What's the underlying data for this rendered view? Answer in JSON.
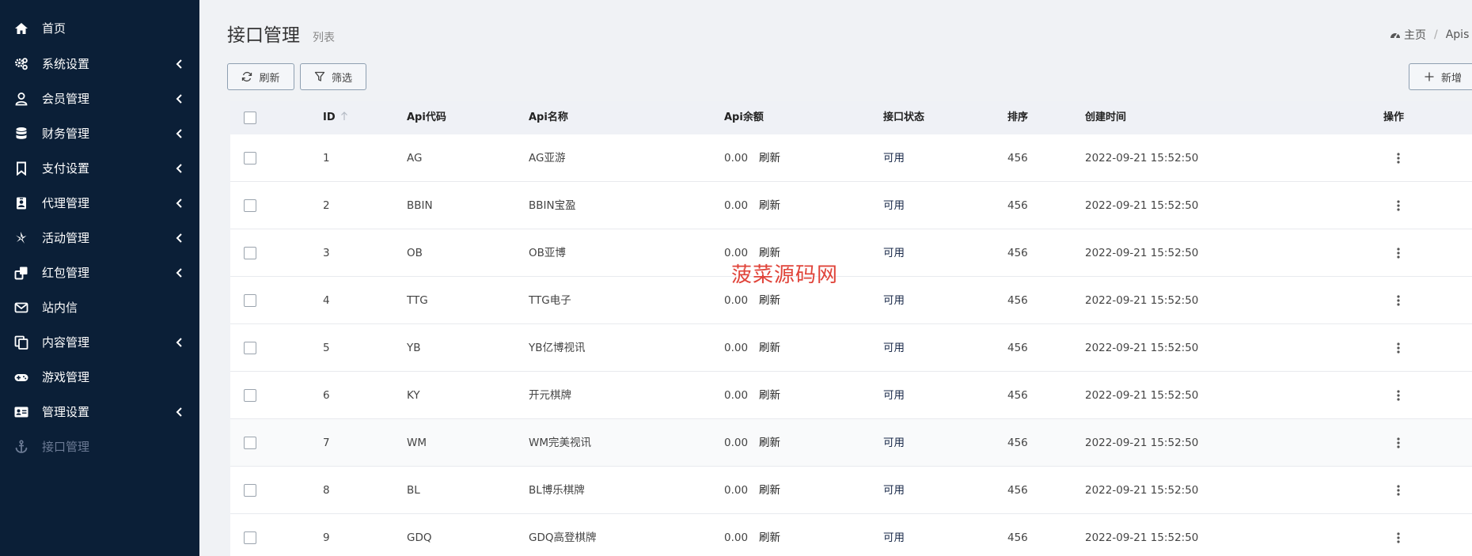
{
  "sidebar": {
    "items": [
      {
        "label": "首页",
        "icon": "home-icon",
        "has_chevron": false
      },
      {
        "label": "系统设置",
        "icon": "cogs-icon",
        "has_chevron": true
      },
      {
        "label": "会员管理",
        "icon": "user-icon",
        "has_chevron": true
      },
      {
        "label": "财务管理",
        "icon": "database-icon",
        "has_chevron": true
      },
      {
        "label": "支付设置",
        "icon": "bookmark-icon",
        "has_chevron": true
      },
      {
        "label": "代理管理",
        "icon": "id-badge-icon",
        "has_chevron": true
      },
      {
        "label": "活动管理",
        "icon": "pinwheel-icon",
        "has_chevron": true
      },
      {
        "label": "红包管理",
        "icon": "clone-icon",
        "has_chevron": true
      },
      {
        "label": "站内信",
        "icon": "envelope-icon",
        "has_chevron": false
      },
      {
        "label": "内容管理",
        "icon": "copy-icon",
        "has_chevron": true
      },
      {
        "label": "游戏管理",
        "icon": "gamepad-icon",
        "has_chevron": false
      },
      {
        "label": "管理设置",
        "icon": "address-card-icon",
        "has_chevron": true
      },
      {
        "label": "接口管理",
        "icon": "anchor-icon",
        "has_chevron": false,
        "active": true
      }
    ]
  },
  "header": {
    "title": "接口管理",
    "subtitle": "列表",
    "breadcrumb": {
      "home": "主页",
      "separator": "/",
      "current": "Apis"
    }
  },
  "toolbar": {
    "refresh_label": "刷新",
    "filter_label": "筛选",
    "add_label": "新增"
  },
  "table": {
    "columns": {
      "id": "ID",
      "code": "Api代码",
      "name": "Api名称",
      "balance": "Api余额",
      "status": "接口状态",
      "sort": "排序",
      "created": "创建时间",
      "actions": "操作"
    },
    "rows": [
      {
        "id": "1",
        "code": "AG",
        "name": "AG亚游",
        "balance": "0.00",
        "refresh": "刷新",
        "status": "可用",
        "sort": "456",
        "created": "2022-09-21 15:52:50"
      },
      {
        "id": "2",
        "code": "BBIN",
        "name": "BBIN宝盈",
        "balance": "0.00",
        "refresh": "刷新",
        "status": "可用",
        "sort": "456",
        "created": "2022-09-21 15:52:50"
      },
      {
        "id": "3",
        "code": "OB",
        "name": "OB亚博",
        "balance": "0.00",
        "refresh": "刷新",
        "status": "可用",
        "sort": "456",
        "created": "2022-09-21 15:52:50"
      },
      {
        "id": "4",
        "code": "TTG",
        "name": "TTG电子",
        "balance": "0.00",
        "refresh": "刷新",
        "status": "可用",
        "sort": "456",
        "created": "2022-09-21 15:52:50"
      },
      {
        "id": "5",
        "code": "YB",
        "name": "YB亿博视讯",
        "balance": "0.00",
        "refresh": "刷新",
        "status": "可用",
        "sort": "456",
        "created": "2022-09-21 15:52:50"
      },
      {
        "id": "6",
        "code": "KY",
        "name": "开元棋牌",
        "balance": "0.00",
        "refresh": "刷新",
        "status": "可用",
        "sort": "456",
        "created": "2022-09-21 15:52:50"
      },
      {
        "id": "7",
        "code": "WM",
        "name": "WM完美视讯",
        "balance": "0.00",
        "refresh": "刷新",
        "status": "可用",
        "sort": "456",
        "created": "2022-09-21 15:52:50"
      },
      {
        "id": "8",
        "code": "BL",
        "name": "BL博乐棋牌",
        "balance": "0.00",
        "refresh": "刷新",
        "status": "可用",
        "sort": "456",
        "created": "2022-09-21 15:52:50"
      },
      {
        "id": "9",
        "code": "GDQ",
        "name": "GDQ高登棋牌",
        "balance": "0.00",
        "refresh": "刷新",
        "status": "可用",
        "sort": "456",
        "created": "2022-09-21 15:52:50"
      }
    ]
  },
  "watermark": "菠菜源码网",
  "colors": {
    "sidebar_bg": "#0b1f37",
    "page_bg": "#f0f2f5",
    "table_header_bg": "#eff1f6",
    "watermark": "#e0443a"
  }
}
